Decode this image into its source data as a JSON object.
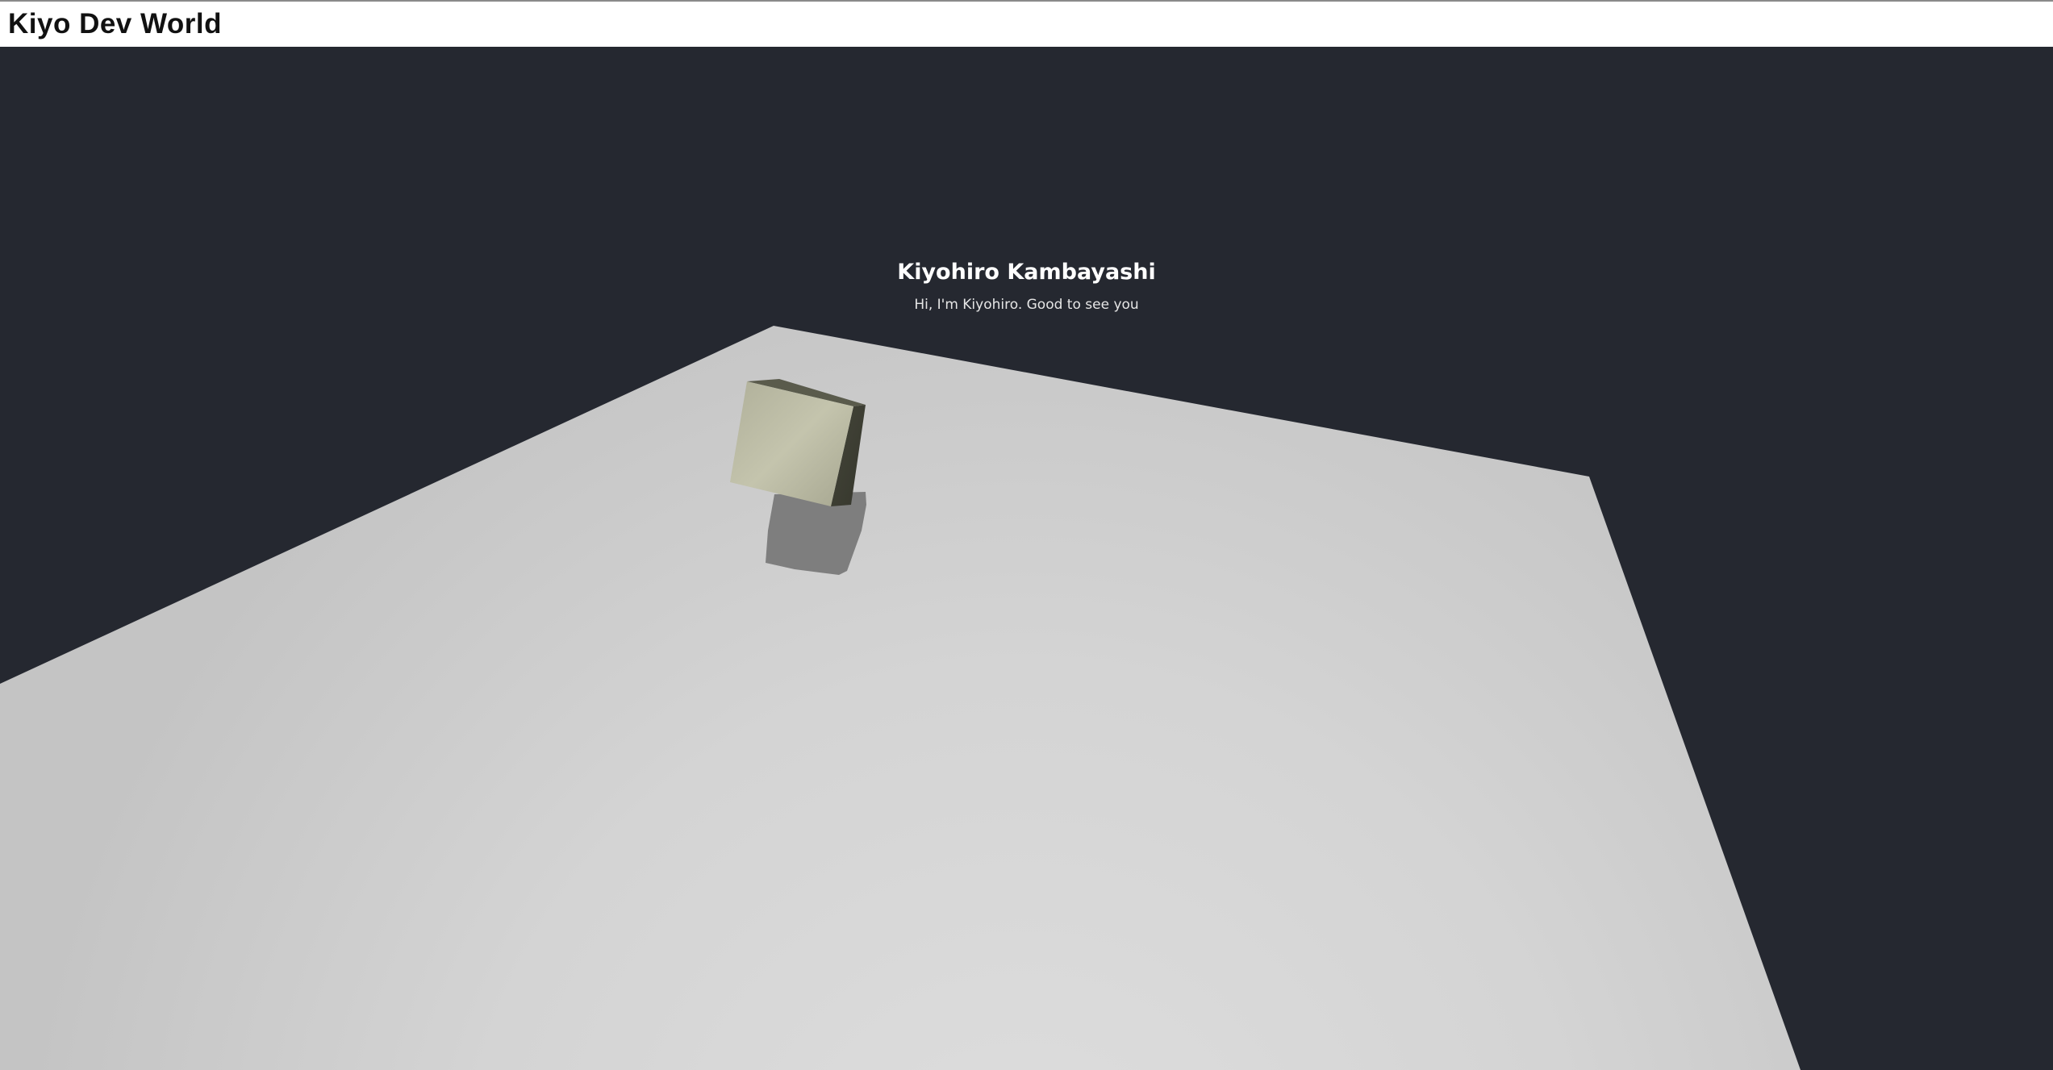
{
  "header": {
    "title": "Kiyo Dev World"
  },
  "hero": {
    "name": "Kiyohiro Kambayashi",
    "greeting": "Hi, I'm Kiyohiro. Good to see you"
  },
  "scene": {
    "background_color": "#252830",
    "floor_color": "#d6d6d6",
    "cube_color": "#b4b49e",
    "shadow_color": "#7e7e7e"
  }
}
